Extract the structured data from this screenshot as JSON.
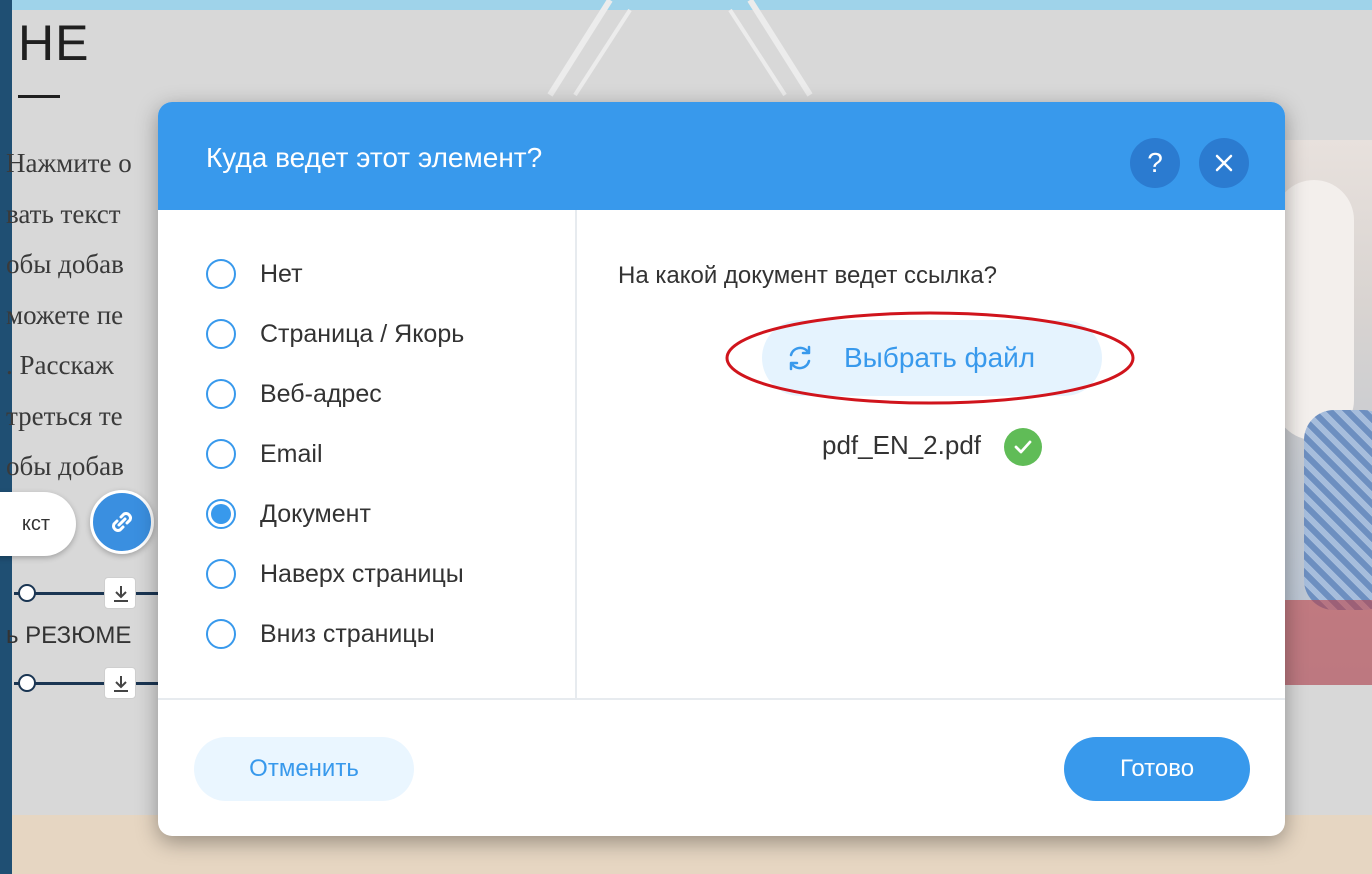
{
  "background": {
    "heading": "НЕ",
    "paragraph_lines": [
      "Нажмите о",
      "вать текст",
      "обы добав",
      "можете пе",
      ". Расскаж",
      "треться те",
      "обы добав"
    ],
    "pill_text": "кст",
    "resume_text": "ь РЕЗЮМЕ"
  },
  "dialog": {
    "title": "Куда ведет этот элемент?",
    "help_label": "?",
    "options": [
      {
        "label": "Нет",
        "selected": false
      },
      {
        "label": "Страница / Якорь",
        "selected": false
      },
      {
        "label": "Веб-адрес",
        "selected": false
      },
      {
        "label": "Email",
        "selected": false
      },
      {
        "label": "Документ",
        "selected": true
      },
      {
        "label": "Наверх страницы",
        "selected": false
      },
      {
        "label": "Вниз страницы",
        "selected": false
      }
    ],
    "question": "На какой документ ведет ссылка?",
    "choose_file_label": "Выбрать файл",
    "file_name": "pdf_EN_2.pdf",
    "cancel_label": "Отменить",
    "done_label": "Готово"
  },
  "colors": {
    "accent": "#3899ec",
    "success": "#60bc57",
    "annotation": "#d0141c"
  }
}
